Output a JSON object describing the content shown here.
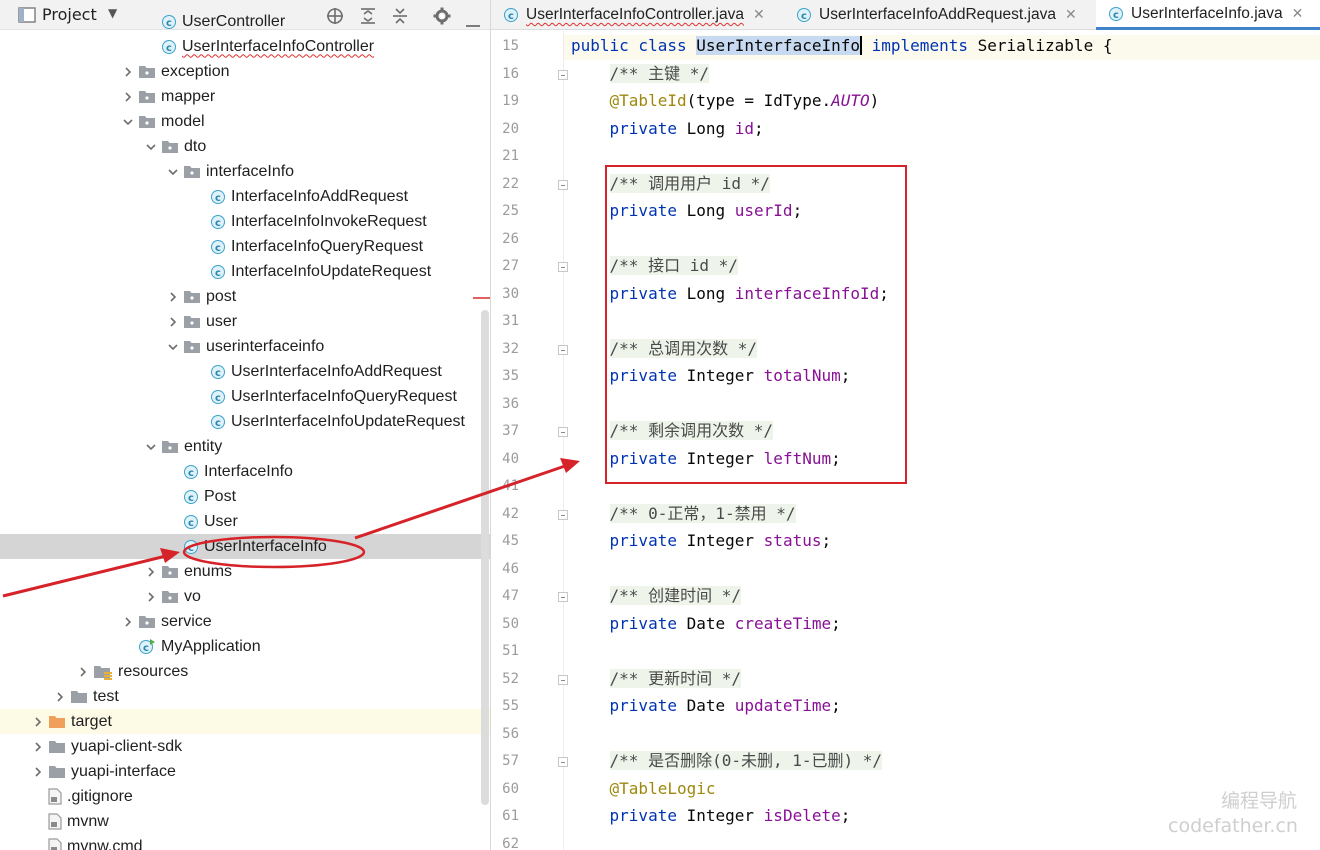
{
  "project_panel": {
    "title": "Project"
  },
  "tree": [
    {
      "label": "UserController",
      "type": "class",
      "depth": 3,
      "arrow": "none",
      "partial": true
    },
    {
      "label": "UserInterfaceInfoController",
      "type": "class",
      "depth": 3,
      "arrow": "none",
      "error": true
    },
    {
      "label": "exception",
      "type": "folder",
      "depth": 2,
      "arrow": "collapsed"
    },
    {
      "label": "mapper",
      "type": "folder",
      "depth": 2,
      "arrow": "collapsed"
    },
    {
      "label": "model",
      "type": "folder",
      "depth": 2,
      "arrow": "expanded"
    },
    {
      "label": "dto",
      "type": "folder",
      "depth": 3,
      "arrow": "expanded"
    },
    {
      "label": "interfaceInfo",
      "type": "folder",
      "depth": 4,
      "arrow": "expanded"
    },
    {
      "label": "InterfaceInfoAddRequest",
      "type": "class",
      "depth": 5,
      "arrow": "none"
    },
    {
      "label": "InterfaceInfoInvokeRequest",
      "type": "class",
      "depth": 5,
      "arrow": "none"
    },
    {
      "label": "InterfaceInfoQueryRequest",
      "type": "class",
      "depth": 5,
      "arrow": "none"
    },
    {
      "label": "InterfaceInfoUpdateRequest",
      "type": "class",
      "depth": 5,
      "arrow": "none"
    },
    {
      "label": "post",
      "type": "folder",
      "depth": 4,
      "arrow": "collapsed"
    },
    {
      "label": "user",
      "type": "folder",
      "depth": 4,
      "arrow": "collapsed"
    },
    {
      "label": "userinterfaceinfo",
      "type": "folder",
      "depth": 4,
      "arrow": "expanded"
    },
    {
      "label": "UserInterfaceInfoAddRequest",
      "type": "class",
      "depth": 5,
      "arrow": "none"
    },
    {
      "label": "UserInterfaceInfoQueryRequest",
      "type": "class",
      "depth": 5,
      "arrow": "none"
    },
    {
      "label": "UserInterfaceInfoUpdateRequest",
      "type": "class",
      "depth": 5,
      "arrow": "none"
    },
    {
      "label": "entity",
      "type": "folder",
      "depth": 3,
      "arrow": "expanded"
    },
    {
      "label": "InterfaceInfo",
      "type": "class",
      "depth": 4,
      "arrow": "none"
    },
    {
      "label": "Post",
      "type": "class",
      "depth": 4,
      "arrow": "none"
    },
    {
      "label": "User",
      "type": "class",
      "depth": 4,
      "arrow": "none"
    },
    {
      "label": "UserInterfaceInfo",
      "type": "class",
      "depth": 4,
      "arrow": "none",
      "selected": true
    },
    {
      "label": "enums",
      "type": "folder",
      "depth": 3,
      "arrow": "collapsed"
    },
    {
      "label": "vo",
      "type": "folder",
      "depth": 3,
      "arrow": "collapsed"
    },
    {
      "label": "service",
      "type": "folder",
      "depth": 2,
      "arrow": "collapsed"
    },
    {
      "label": "MyApplication",
      "type": "app",
      "depth": 2,
      "arrow": "none"
    },
    {
      "label": "resources",
      "type": "resources",
      "depth": 1,
      "arrow": "collapsed"
    },
    {
      "label": "test",
      "type": "folder",
      "depth": 0,
      "arrow": "collapsed"
    },
    {
      "label": "target",
      "type": "folder-orange",
      "depth": -1,
      "arrow": "collapsed",
      "excluded": true
    },
    {
      "label": "yuapi-client-sdk",
      "type": "folder",
      "depth": -1,
      "arrow": "collapsed"
    },
    {
      "label": "yuapi-interface",
      "type": "folder",
      "depth": -1,
      "arrow": "collapsed"
    },
    {
      "label": ".gitignore",
      "type": "file",
      "depth": -1,
      "arrow": "none"
    },
    {
      "label": "mvnw",
      "type": "file",
      "depth": -1,
      "arrow": "none"
    },
    {
      "label": "mvnw.cmd",
      "type": "file",
      "depth": -1,
      "arrow": "none",
      "partial": true
    }
  ],
  "tabs": [
    {
      "label": "UserInterfaceInfoController.java",
      "active": false,
      "error": true
    },
    {
      "label": "UserInterfaceInfoAddRequest.java",
      "active": false,
      "error": false
    },
    {
      "label": "UserInterfaceInfo.java",
      "active": true,
      "error": false
    }
  ],
  "code_lines": [
    {
      "n": "15",
      "fold": false,
      "tokens": [
        [
          "kw",
          "public class "
        ],
        [
          "sel",
          "UserInterfaceInfo"
        ],
        [
          "caret",
          ""
        ],
        [
          "plain",
          " "
        ],
        [
          "kw",
          "implements"
        ],
        [
          "plain",
          " Serializable {"
        ]
      ]
    },
    {
      "n": "16",
      "fold": true,
      "tokens": [
        [
          "plain",
          "    "
        ],
        [
          "cmt",
          "/** 主键 */"
        ]
      ]
    },
    {
      "n": "19",
      "fold": false,
      "tokens": [
        [
          "plain",
          "    "
        ],
        [
          "ann",
          "@TableId"
        ],
        [
          "plain",
          "(type = IdType."
        ],
        [
          "enm",
          "AUTO"
        ],
        [
          "plain",
          ")"
        ]
      ]
    },
    {
      "n": "20",
      "fold": false,
      "tokens": [
        [
          "plain",
          "    "
        ],
        [
          "kw",
          "private"
        ],
        [
          "plain",
          " Long "
        ],
        [
          "fld",
          "id"
        ],
        [
          "plain",
          ";"
        ]
      ]
    },
    {
      "n": "21",
      "fold": false,
      "tokens": []
    },
    {
      "n": "22",
      "fold": true,
      "tokens": [
        [
          "plain",
          "    "
        ],
        [
          "cmt",
          "/** 调用用户 id */"
        ]
      ]
    },
    {
      "n": "25",
      "fold": false,
      "tokens": [
        [
          "plain",
          "    "
        ],
        [
          "kw",
          "private"
        ],
        [
          "plain",
          " Long "
        ],
        [
          "fld",
          "userId"
        ],
        [
          "plain",
          ";"
        ]
      ]
    },
    {
      "n": "26",
      "fold": false,
      "tokens": []
    },
    {
      "n": "27",
      "fold": true,
      "tokens": [
        [
          "plain",
          "    "
        ],
        [
          "cmt",
          "/** 接口 id */"
        ]
      ]
    },
    {
      "n": "30",
      "fold": false,
      "tokens": [
        [
          "plain",
          "    "
        ],
        [
          "kw",
          "private"
        ],
        [
          "plain",
          " Long "
        ],
        [
          "fld",
          "interfaceInfoId"
        ],
        [
          "plain",
          ";"
        ]
      ]
    },
    {
      "n": "31",
      "fold": false,
      "tokens": []
    },
    {
      "n": "32",
      "fold": true,
      "tokens": [
        [
          "plain",
          "    "
        ],
        [
          "cmt",
          "/** 总调用次数 */"
        ]
      ]
    },
    {
      "n": "35",
      "fold": false,
      "tokens": [
        [
          "plain",
          "    "
        ],
        [
          "kw",
          "private"
        ],
        [
          "plain",
          " Integer "
        ],
        [
          "fld",
          "totalNum"
        ],
        [
          "plain",
          ";"
        ]
      ]
    },
    {
      "n": "36",
      "fold": false,
      "tokens": []
    },
    {
      "n": "37",
      "fold": true,
      "tokens": [
        [
          "plain",
          "    "
        ],
        [
          "cmt",
          "/** 剩余调用次数 */"
        ]
      ]
    },
    {
      "n": "40",
      "fold": false,
      "tokens": [
        [
          "plain",
          "    "
        ],
        [
          "kw",
          "private"
        ],
        [
          "plain",
          " Integer "
        ],
        [
          "fld",
          "leftNum"
        ],
        [
          "plain",
          ";"
        ]
      ]
    },
    {
      "n": "41",
      "fold": false,
      "tokens": []
    },
    {
      "n": "42",
      "fold": true,
      "tokens": [
        [
          "plain",
          "    "
        ],
        [
          "cmt",
          "/** 0-正常，1-禁用 */"
        ]
      ]
    },
    {
      "n": "45",
      "fold": false,
      "tokens": [
        [
          "plain",
          "    "
        ],
        [
          "kw",
          "private"
        ],
        [
          "plain",
          " Integer "
        ],
        [
          "fld",
          "status"
        ],
        [
          "plain",
          ";"
        ]
      ]
    },
    {
      "n": "46",
      "fold": false,
      "tokens": []
    },
    {
      "n": "47",
      "fold": true,
      "tokens": [
        [
          "plain",
          "    "
        ],
        [
          "cmt",
          "/** 创建时间 */"
        ]
      ]
    },
    {
      "n": "50",
      "fold": false,
      "tokens": [
        [
          "plain",
          "    "
        ],
        [
          "kw",
          "private"
        ],
        [
          "plain",
          " Date "
        ],
        [
          "fld",
          "createTime"
        ],
        [
          "plain",
          ";"
        ]
      ]
    },
    {
      "n": "51",
      "fold": false,
      "tokens": []
    },
    {
      "n": "52",
      "fold": true,
      "tokens": [
        [
          "plain",
          "    "
        ],
        [
          "cmt",
          "/** 更新时间 */"
        ]
      ]
    },
    {
      "n": "55",
      "fold": false,
      "tokens": [
        [
          "plain",
          "    "
        ],
        [
          "kw",
          "private"
        ],
        [
          "plain",
          " Date "
        ],
        [
          "fld",
          "updateTime"
        ],
        [
          "plain",
          ";"
        ]
      ]
    },
    {
      "n": "56",
      "fold": false,
      "tokens": []
    },
    {
      "n": "57",
      "fold": true,
      "tokens": [
        [
          "plain",
          "    "
        ],
        [
          "cmt",
          "/** 是否删除(0-未删, 1-已删) */"
        ]
      ]
    },
    {
      "n": "60",
      "fold": false,
      "tokens": [
        [
          "plain",
          "    "
        ],
        [
          "ann",
          "@TableLogic"
        ]
      ]
    },
    {
      "n": "61",
      "fold": false,
      "tokens": [
        [
          "plain",
          "    "
        ],
        [
          "kw",
          "private"
        ],
        [
          "plain",
          " Integer "
        ],
        [
          "fld",
          "isDelete"
        ],
        [
          "plain",
          ";"
        ]
      ]
    },
    {
      "n": "62",
      "fold": false,
      "tokens": []
    }
  ],
  "watermark": {
    "line1": "编程导航",
    "line2": "codefather.cn"
  },
  "colors": {
    "accent": "#4083c9",
    "annotation_red": "#d6232a",
    "class_icon": "#3aa3c9"
  }
}
